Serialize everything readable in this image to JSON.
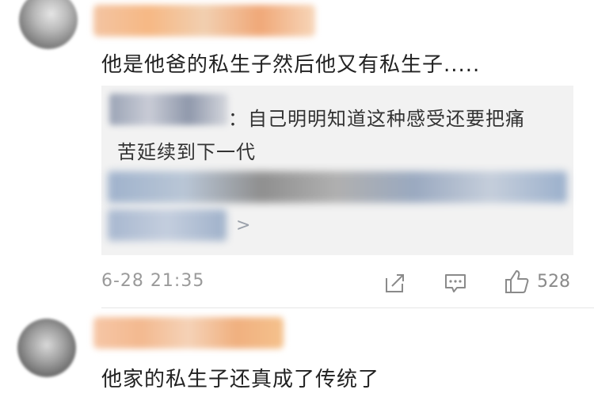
{
  "comments": [
    {
      "text": "他是他爸的私生子然后他又有私生子.....",
      "reply": {
        "line1": "：自己明明知道这种感受还要把痛",
        "line2": "苦延续到下一代",
        "more_label": ">"
      },
      "timestamp": "6-28 21:35",
      "actions": {
        "like_count": "528"
      }
    },
    {
      "text": "他家的私生子还真成了传统了"
    }
  ],
  "icons": {
    "repost": "share-icon",
    "comment": "comment-icon",
    "like": "thumbs-up-icon"
  }
}
